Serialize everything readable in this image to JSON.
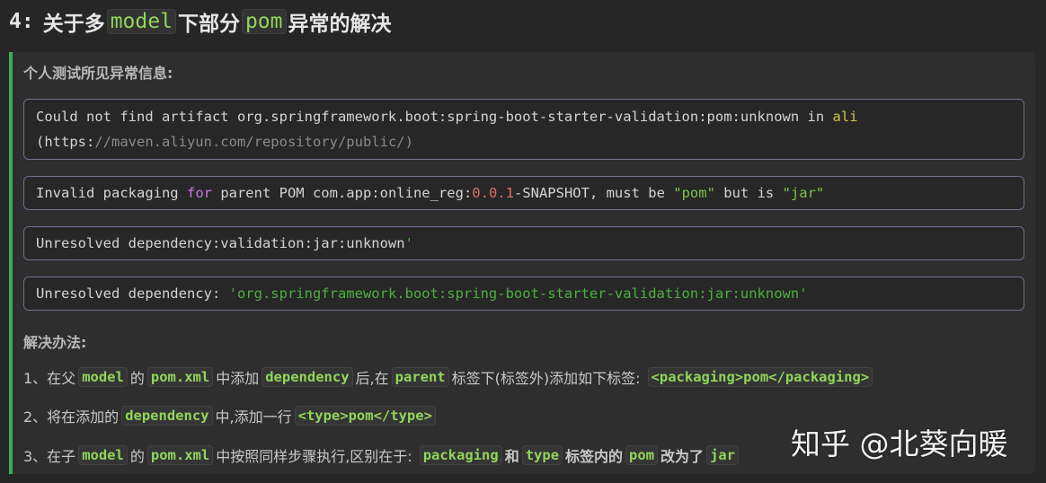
{
  "heading": {
    "number": "4:",
    "part1": "关于多",
    "code1": "model",
    "part2": "下部分",
    "code2": "pom",
    "part3": "异常的解决"
  },
  "error_title": "个人测试所见异常信息:",
  "errors": {
    "e1": {
      "l1a": "Could not find artifact org.springframework.boot:spring-boot-starter-validation:pom:unknown in ",
      "l1b": "ali",
      "l2a": "(https:",
      "l2b": "//maven.aliyun.com/repository/public/)"
    },
    "e2": {
      "a": "Invalid packaging ",
      "kw": "for",
      "b": " parent POM com.app:online_reg:",
      "num": "0.0.1",
      "c": "-SNAPSHOT, must be ",
      "s1": "\"pom\"",
      "d": " but is ",
      "s2": "\"jar\""
    },
    "e3": {
      "a": "Unresolved dependency:validation:jar:unknown",
      "b": "'"
    },
    "e4": {
      "a": "Unresolved dependency: ",
      "b": "'org.springframework.boot:spring-boot-starter-validation:jar:unknown'"
    }
  },
  "solution_title": "解决办法:",
  "steps": {
    "s1": {
      "t1": "1、在父",
      "c1": "model",
      "t2": "的",
      "c2": "pom.xml",
      "t3": "中添加",
      "c3": "dependency",
      "t4": "后,在",
      "c4": "parent",
      "t5": "标签下(标签外)添加如下标签:",
      "c5": "<packaging>pom</packaging>"
    },
    "s2": {
      "t1": "2、将在添加的",
      "c1": "dependency",
      "t2": "中,添加一行",
      "c2": "<type>pom</type>"
    },
    "s3": {
      "t1": "3、在子",
      "c1": "model",
      "t2": "的",
      "c2": "pom.xml",
      "t3": "中按照同样步骤执行,区别在于:",
      "c3": "packaging",
      "t4": "和",
      "c4": "type",
      "t5": "标签内的",
      "c5": "pom",
      "t6": "改为了",
      "c6": "jar"
    }
  },
  "watermark": "知乎 @北葵向暖"
}
